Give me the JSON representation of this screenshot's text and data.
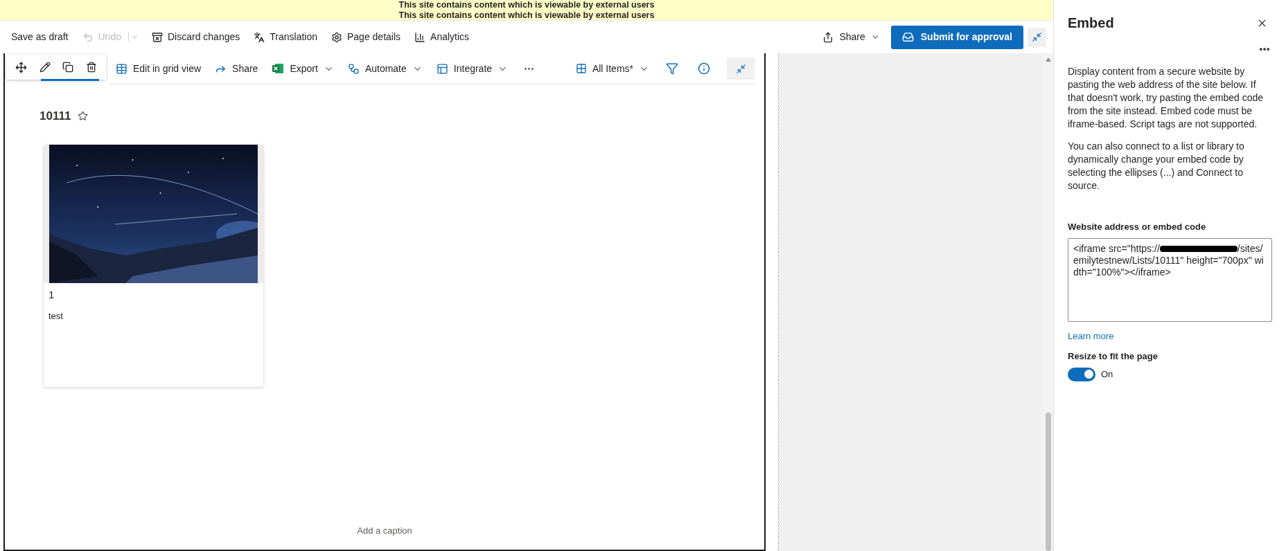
{
  "banner": {
    "lines": [
      "This site contains content which is viewable by external users",
      "This site contains content which is viewable by external users"
    ]
  },
  "command_bar": {
    "items": [
      {
        "kind": "save",
        "label": "Save as draft",
        "disabled": false
      },
      {
        "kind": "undo",
        "label": "Undo",
        "disabled": true
      },
      {
        "kind": "discard",
        "label": "Discard changes",
        "disabled": false
      },
      {
        "kind": "translation",
        "label": "Translation",
        "disabled": false
      },
      {
        "kind": "details",
        "label": "Page details",
        "disabled": false
      },
      {
        "kind": "analytics",
        "label": "Analytics",
        "disabled": false
      }
    ],
    "share": {
      "label": "Share"
    },
    "submit": {
      "label": "Submit for approval"
    }
  },
  "list_toolbar": {
    "items": [
      {
        "kind": "grid",
        "label": "Edit in grid view",
        "dropdown": false
      },
      {
        "kind": "share",
        "label": "Share",
        "dropdown": false
      },
      {
        "kind": "export",
        "label": "Export",
        "dropdown": true
      },
      {
        "kind": "automate",
        "label": "Automate",
        "dropdown": true
      },
      {
        "kind": "integrate",
        "label": "Integrate",
        "dropdown": true
      }
    ],
    "view": {
      "label": "All Items*"
    }
  },
  "list": {
    "title": "10111",
    "favorite": false,
    "cards": [
      {
        "title": "1",
        "text": "test"
      }
    ]
  },
  "caption": {
    "placeholder": "Add a caption"
  },
  "panel": {
    "title": "Embed",
    "paragraphs": [
      "Display content from a secure website by pasting the web address of the site below. If that doesn't work, try pasting the embed code from the site instead. Embed code must be iframe-based. Script tags are not supported.",
      "You can also connect to a list or library to dynamically change your embed code by selecting the ellipses (...) and Connect to source."
    ],
    "field": {
      "label": "Website address or embed code",
      "value_before": "<iframe src=\"https://",
      "value_after": "/sites/emilytestnew/Lists/10111\" height=\"700px\" width=\"100%\"></iframe>"
    },
    "link": "Learn more",
    "toggle": {
      "label": "Resize to fit the page",
      "on": true,
      "state_text": "On"
    }
  }
}
